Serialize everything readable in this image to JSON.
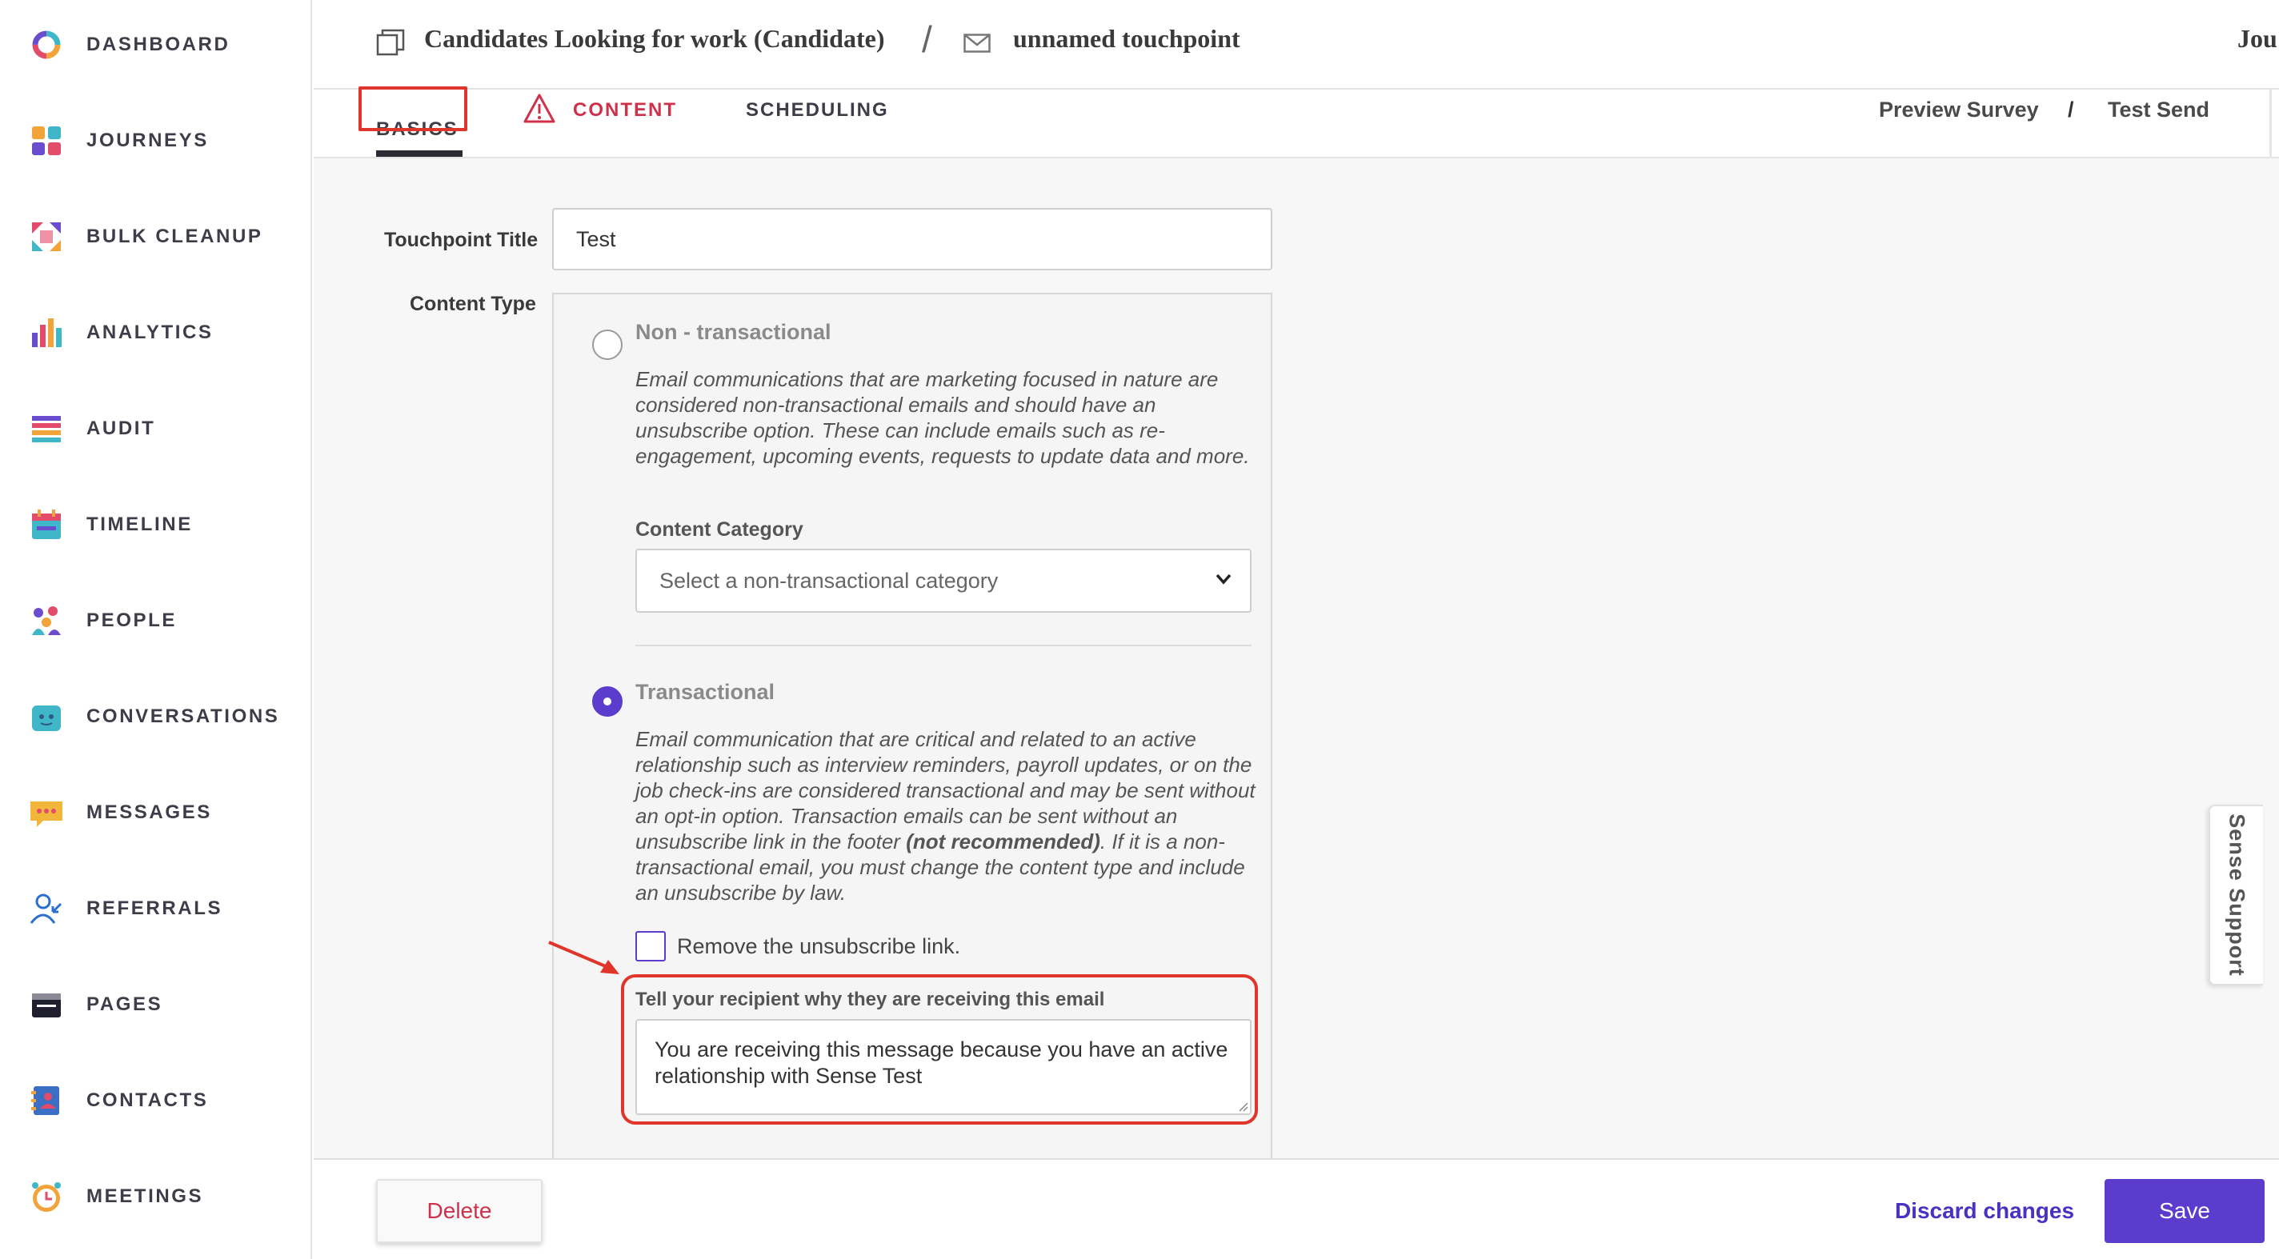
{
  "sidebar": {
    "items": [
      {
        "label": "DASHBOARD",
        "icon": "dashboard-ring-icon"
      },
      {
        "label": "JOURNEYS",
        "icon": "journeys-grid-icon"
      },
      {
        "label": "BULK CLEANUP",
        "icon": "bulk-cleanup-arrows-icon"
      },
      {
        "label": "ANALYTICS",
        "icon": "analytics-bars-icon"
      },
      {
        "label": "AUDIT",
        "icon": "audit-list-icon"
      },
      {
        "label": "TIMELINE",
        "icon": "timeline-calendar-icon"
      },
      {
        "label": "PEOPLE",
        "icon": "people-group-icon"
      },
      {
        "label": "CONVERSATIONS",
        "icon": "conversations-bot-icon"
      },
      {
        "label": "MESSAGES",
        "icon": "messages-bubble-icon"
      },
      {
        "label": "REFERRALS",
        "icon": "referrals-user-icon"
      },
      {
        "label": "PAGES",
        "icon": "pages-browser-icon"
      },
      {
        "label": "CONTACTS",
        "icon": "contacts-book-icon"
      },
      {
        "label": "MEETINGS",
        "icon": "meetings-clock-icon"
      }
    ]
  },
  "header": {
    "journey_title": "Candidates Looking for work (Candidate)",
    "separator": "/",
    "touchpoint_name": "unnamed touchpoint",
    "right_truncated": "Jou"
  },
  "tabs": {
    "basics": "BASICS",
    "content": "CONTENT",
    "scheduling": "SCHEDULING",
    "preview_survey": "Preview Survey",
    "link_separator": "/",
    "test_send": "Test Send"
  },
  "form": {
    "touchpoint_title_label": "Touchpoint Title",
    "touchpoint_title_value": "Test",
    "content_type_label": "Content Type",
    "non_transactional": {
      "title": "Non - transactional",
      "description": "Email communications that are marketing focused in nature are considered non-transactional emails and should have an unsubscribe option. These can include emails such as re-engagement, upcoming events, requests to update data and more.",
      "selected": false
    },
    "content_category_label": "Content Category",
    "content_category_placeholder": "Select a non-transactional category",
    "transactional": {
      "title": "Transactional",
      "description_part1": "Email communication that are critical and related to an active relationship such as interview reminders, payroll updates, or on the job check-ins are considered transactional and may be sent without an opt-in option. Transaction emails can be sent without an unsubscribe link in the footer ",
      "description_bold": "(not recommended)",
      "description_part2": ". If it is a non-transactional email, you must change the content type and include an unsubscribe by law.",
      "selected": true
    },
    "remove_unsubscribe_label": "Remove the unsubscribe link.",
    "remove_unsubscribe_checked": false,
    "reason_label": "Tell your recipient why they are receiving this email",
    "reason_value": "You are receiving this message because you have an active relationship with Sense Test"
  },
  "footer": {
    "delete_label": "Delete",
    "discard_label": "Discard changes",
    "save_label": "Save"
  },
  "support_tab_label": "Sense Support",
  "colors": {
    "accent_purple": "#5b3ccc",
    "danger_red": "#d0314a",
    "annotation_red": "#e0352b"
  }
}
